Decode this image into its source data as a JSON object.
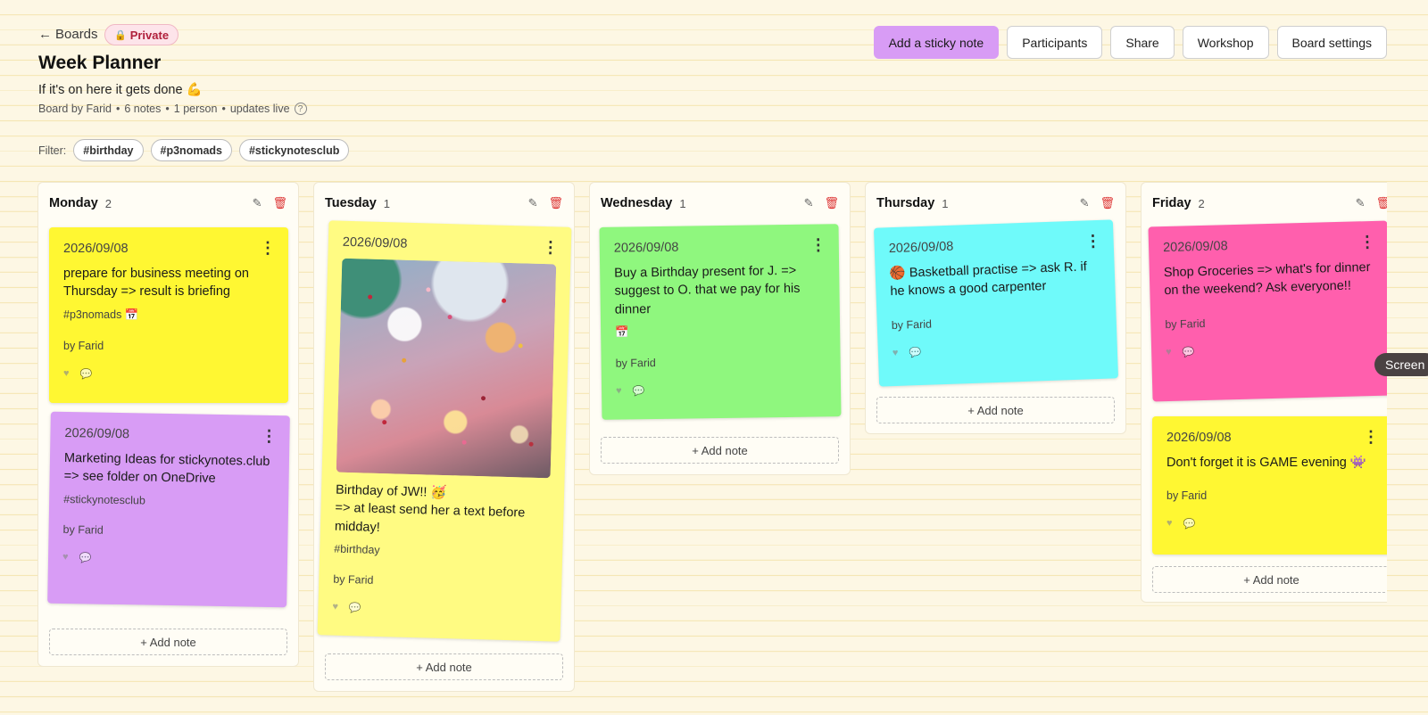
{
  "header": {
    "back_label": "Boards",
    "privacy_label": "Private",
    "title": "Week Planner",
    "description": "If it's on here it gets done 💪",
    "meta": {
      "author": "Board by Farid",
      "notes": "6 notes",
      "people": "1 person",
      "status": "updates live",
      "separator": "•"
    },
    "actions": {
      "add_note": "Add a sticky note",
      "participants": "Participants",
      "share": "Share",
      "workshop": "Workshop",
      "settings": "Board settings"
    }
  },
  "filter": {
    "label": "Filter:",
    "tags": [
      "#birthday",
      "#p3nomads",
      "#stickynotesclub"
    ]
  },
  "columns": [
    {
      "title": "Monday",
      "count": "2",
      "add_label": "+ Add note",
      "notes": [
        {
          "date": "2026/09/08",
          "text": "prepare for business meeting on Thursday => result is briefing",
          "tag": "#p3nomads 📅",
          "author": "by Farid",
          "color": "#fff732"
        },
        {
          "date": "2026/09/08",
          "text": "Marketing Ideas for stickynotes.club => see folder on OneDrive",
          "tag": "#stickynotesclub",
          "author": "by Farid",
          "color": "#d89cf5"
        }
      ]
    },
    {
      "title": "Tuesday",
      "count": "1",
      "add_label": "+ Add note",
      "notes": [
        {
          "date": "2026/09/08",
          "text": "Birthday of JW!! 🥳\n=> at least send her a text before midday!",
          "tag": "#birthday",
          "author": "by Farid",
          "color": "#fffb82",
          "image": "confetti-party-photo"
        }
      ]
    },
    {
      "title": "Wednesday",
      "count": "1",
      "add_label": "+ Add note",
      "notes": [
        {
          "date": "2026/09/08",
          "text": "Buy a Birthday present for J. => suggest to O. that we pay for his dinner",
          "tag": "📅",
          "author": "by Farid",
          "color": "#8ff77e"
        }
      ]
    },
    {
      "title": "Thursday",
      "count": "1",
      "add_label": "+ Add note",
      "notes": [
        {
          "date": "2026/09/08",
          "text": "🏀 Basketball practise => ask R. if he knows a good carpenter",
          "author": "by Farid",
          "color": "#6ffafa"
        }
      ]
    },
    {
      "title": "Friday",
      "count": "2",
      "add_label": "+ Add note",
      "notes": [
        {
          "date": "2026/09/08",
          "text": "Shop Groceries => what's for dinner on the weekend? Ask everyone!!",
          "author": "by Farid",
          "color": "#ff5fad"
        },
        {
          "date": "2026/09/08",
          "text": "Don't forget it is GAME evening 👾",
          "author": "by Farid",
          "color": "#fff732"
        }
      ]
    }
  ],
  "icons": {
    "back": "←",
    "lock": "🔒",
    "help": "?",
    "edit": "✎",
    "delete": "🗑",
    "menu": "⋮",
    "heart": "♥",
    "comment": "💬"
  },
  "overlay": {
    "label": "Screen"
  }
}
